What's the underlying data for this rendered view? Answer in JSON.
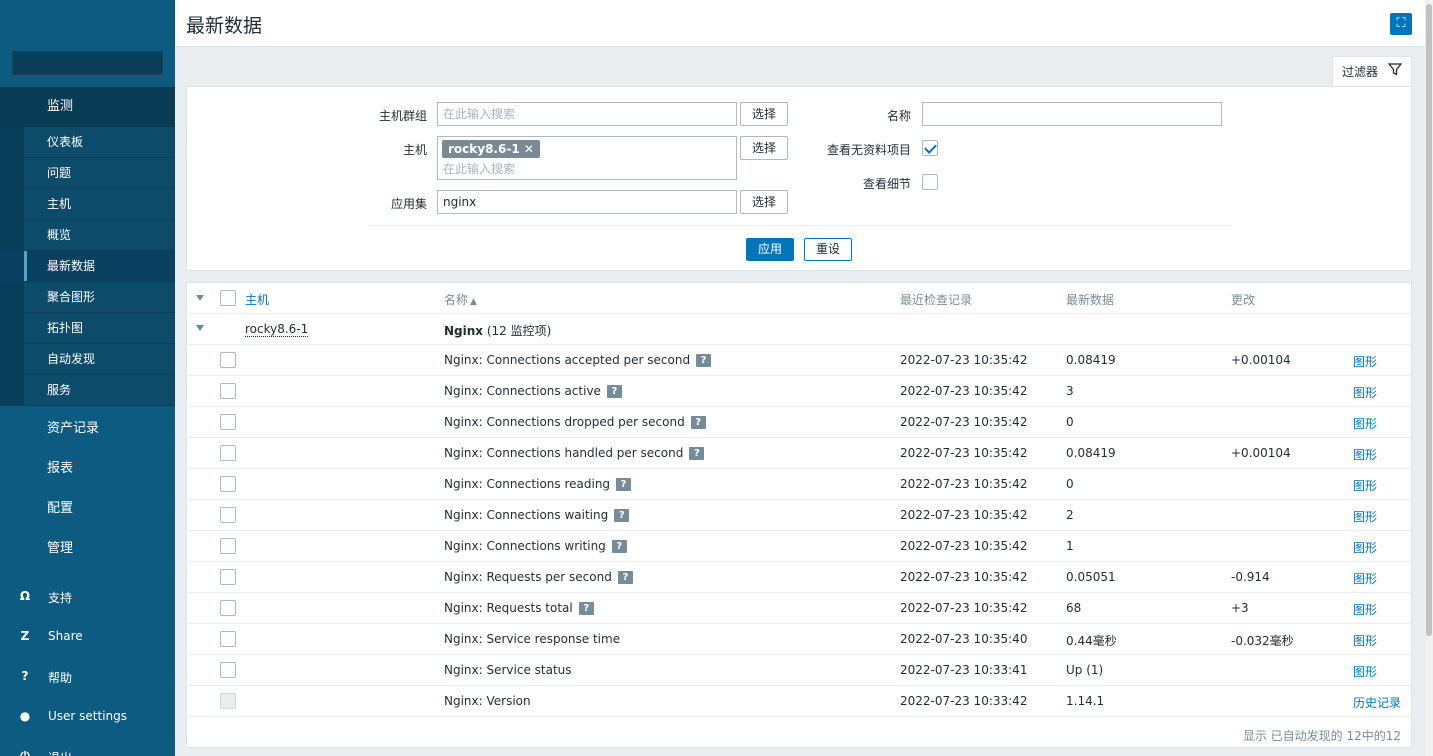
{
  "sidebar": {
    "active_section": "监测",
    "sub_items": [
      {
        "label": "仪表板",
        "active": false
      },
      {
        "label": "问题",
        "active": false
      },
      {
        "label": "主机",
        "active": false
      },
      {
        "label": "概览",
        "active": false
      },
      {
        "label": "最新数据",
        "active": true
      },
      {
        "label": "聚合图形",
        "active": false
      },
      {
        "label": "拓扑图",
        "active": false
      },
      {
        "label": "自动发现",
        "active": false
      },
      {
        "label": "服务",
        "active": false
      }
    ],
    "sections": [
      "资产记录",
      "报表",
      "配置",
      "管理"
    ],
    "footer": [
      {
        "icon": "headset-icon",
        "glyph": "Ω",
        "label": "支持"
      },
      {
        "icon": "share-icon",
        "glyph": "Z",
        "label": "Share"
      },
      {
        "icon": "help-icon",
        "glyph": "?",
        "label": "帮助"
      },
      {
        "icon": "user-icon",
        "glyph": "●",
        "label": "User settings"
      },
      {
        "icon": "logout-icon",
        "glyph": "⏻",
        "label": "退出"
      }
    ]
  },
  "header": {
    "title": "最新数据"
  },
  "filter": {
    "tab_label": "过滤器",
    "host_group_label": "主机群组",
    "host_group_placeholder": "在此输入搜索",
    "select_label": "选择",
    "host_label": "主机",
    "host_tag": "rocky8.6-1",
    "host_placeholder": "在此输入搜索",
    "app_label": "应用集",
    "app_value": "nginx",
    "name_label": "名称",
    "name_value": "",
    "show_no_data_label": "查看无资料项目",
    "show_no_data_checked": true,
    "show_details_label": "查看细节",
    "show_details_checked": false,
    "apply_label": "应用",
    "reset_label": "重设"
  },
  "table": {
    "headers": {
      "host": "主机",
      "name": "名称",
      "sort_indicator": "▲",
      "last_check": "最近检查记录",
      "last_value": "最新数据",
      "change": "更改"
    },
    "group": {
      "host": "rocky8.6-1",
      "app_name": "Nginx",
      "app_count": "(12 监控项)"
    },
    "rows": [
      {
        "name": "Nginx: Connections accepted per second",
        "help": true,
        "last_check": "2022-07-23 10:35:42",
        "last_value": "0.08419",
        "change": "+0.00104",
        "action": "图形",
        "disabled": false
      },
      {
        "name": "Nginx: Connections active",
        "help": true,
        "last_check": "2022-07-23 10:35:42",
        "last_value": "3",
        "change": "",
        "action": "图形",
        "disabled": false
      },
      {
        "name": "Nginx: Connections dropped per second",
        "help": true,
        "last_check": "2022-07-23 10:35:42",
        "last_value": "0",
        "change": "",
        "action": "图形",
        "disabled": false
      },
      {
        "name": "Nginx: Connections handled per second",
        "help": true,
        "last_check": "2022-07-23 10:35:42",
        "last_value": "0.08419",
        "change": "+0.00104",
        "action": "图形",
        "disabled": false
      },
      {
        "name": "Nginx: Connections reading",
        "help": true,
        "last_check": "2022-07-23 10:35:42",
        "last_value": "0",
        "change": "",
        "action": "图形",
        "disabled": false
      },
      {
        "name": "Nginx: Connections waiting",
        "help": true,
        "last_check": "2022-07-23 10:35:42",
        "last_value": "2",
        "change": "",
        "action": "图形",
        "disabled": false
      },
      {
        "name": "Nginx: Connections writing",
        "help": true,
        "last_check": "2022-07-23 10:35:42",
        "last_value": "1",
        "change": "",
        "action": "图形",
        "disabled": false
      },
      {
        "name": "Nginx: Requests per second",
        "help": true,
        "last_check": "2022-07-23 10:35:42",
        "last_value": "0.05051",
        "change": "-0.914",
        "action": "图形",
        "disabled": false
      },
      {
        "name": "Nginx: Requests total",
        "help": true,
        "last_check": "2022-07-23 10:35:42",
        "last_value": "68",
        "change": "+3",
        "action": "图形",
        "disabled": false
      },
      {
        "name": "Nginx: Service response time",
        "help": false,
        "last_check": "2022-07-23 10:35:40",
        "last_value": "0.44毫秒",
        "change": "-0.032毫秒",
        "action": "图形",
        "disabled": false
      },
      {
        "name": "Nginx: Service status",
        "help": false,
        "last_check": "2022-07-23 10:33:41",
        "last_value": "Up (1)",
        "change": "",
        "action": "图形",
        "disabled": false
      },
      {
        "name": "Nginx: Version",
        "help": false,
        "last_check": "2022-07-23 10:33:42",
        "last_value": "1.14.1",
        "change": "",
        "action": "历史记录",
        "disabled": true
      }
    ],
    "footer": "显示 已自动发现的 12中的12"
  }
}
